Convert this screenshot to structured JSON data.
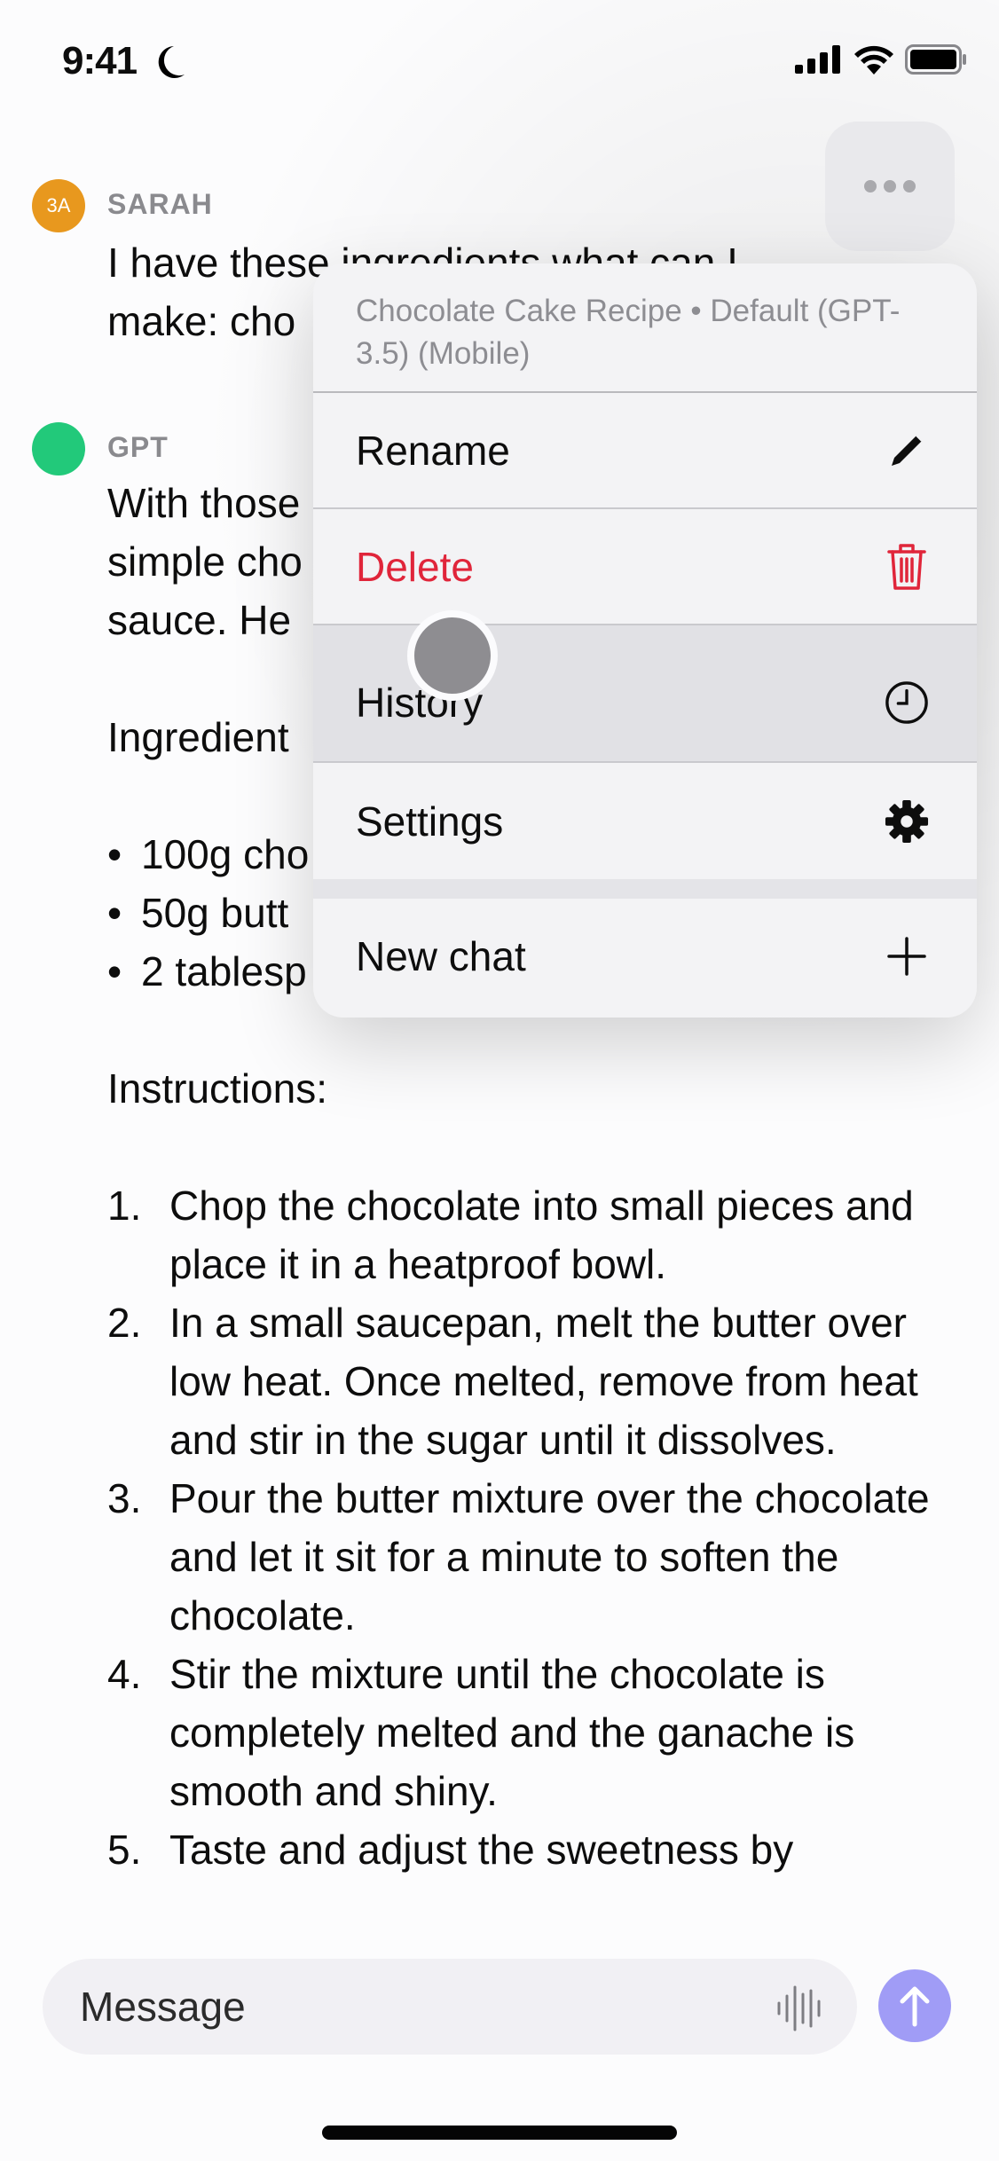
{
  "status_bar": {
    "time": "9:41",
    "icons": [
      "moon-icon",
      "signal-icon",
      "wifi-icon",
      "battery-icon"
    ]
  },
  "colors": {
    "user_avatar": "#E8981E",
    "gpt_avatar": "#22C97A",
    "danger": "#E0253A",
    "send_button": "#A09CF6"
  },
  "conversation": {
    "user_message": {
      "avatar_initials": "3A",
      "sender": "SARAH",
      "lines": [
        "I have these ingredients what can I",
        "make: cho"
      ]
    },
    "gpt_message": {
      "sender": "GPT",
      "intro_lines": [
        "With those",
        "simple cho",
        "sauce. He"
      ],
      "ingredients_heading": "Ingredient",
      "ingredients": [
        "100g cho",
        "50g butt",
        "2 tablesp"
      ],
      "instructions_heading": "Instructions:",
      "steps": [
        {
          "num": "1.",
          "text": "Chop the chocolate into small pieces and place it in a heatproof bowl."
        },
        {
          "num": "2.",
          "text": "In a small saucepan, melt the butter over low heat. Once melted, remove from heat and stir in the sugar until it dissolves."
        },
        {
          "num": "3.",
          "text": "Pour the butter mixture over the chocolate and let it sit for a minute to soften the chocolate."
        },
        {
          "num": "4.",
          "text": "Stir the mixture until the chocolate is completely melted and the ganache is smooth and shiny."
        },
        {
          "num": "5.",
          "text": "Taste and adjust the sweetness by"
        }
      ]
    }
  },
  "more_button": {
    "icon": "ellipsis-icon"
  },
  "context_menu": {
    "header": "Chocolate Cake Recipe • Default (GPT-3.5) (Mobile)",
    "items": [
      {
        "label": "Rename",
        "icon": "pencil-icon"
      },
      {
        "label": "Delete",
        "icon": "trash-icon"
      },
      {
        "label": "History",
        "icon": "clock-icon",
        "highlighted": true
      },
      {
        "label": "Settings",
        "icon": "gear-icon"
      },
      {
        "label": "New chat",
        "icon": "plus-icon"
      }
    ]
  },
  "composer": {
    "placeholder": "Message",
    "value": "",
    "voice_icon": "waveform-icon",
    "send_icon": "arrow-up-icon"
  }
}
